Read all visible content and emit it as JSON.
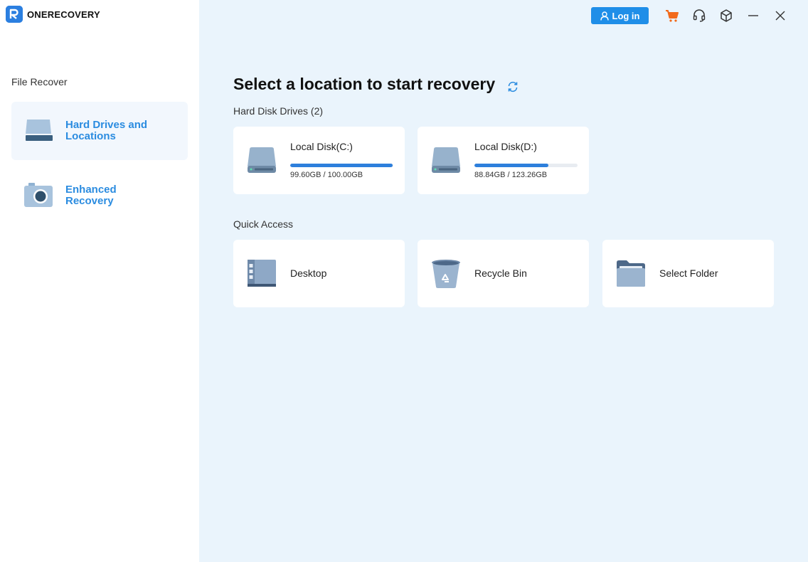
{
  "app": {
    "brand_name": "ONERECOVERY",
    "accent_color": "#2b8ce0",
    "login_label": "Log in"
  },
  "topbar": {
    "icons": [
      "user-icon",
      "cart-icon",
      "headset-icon",
      "cube-icon",
      "minimize-icon",
      "close-icon"
    ]
  },
  "sidebar": {
    "section_label": "File Recover",
    "items": [
      {
        "label": "Hard Drives and Locations",
        "icon": "hard-drive-icon",
        "active": true
      },
      {
        "label": "Enhanced Recovery",
        "icon": "camera-icon",
        "active": false
      }
    ]
  },
  "main": {
    "title": "Select a location to start recovery",
    "hdd_group_label": "Hard Disk Drives (2)",
    "disks": [
      {
        "name": "Local Disk(C:)",
        "size_text": "99.60GB / 100.00GB",
        "used_fraction": 0.996
      },
      {
        "name": "Local Disk(D:)",
        "size_text": "88.84GB / 123.26GB",
        "used_fraction": 0.72
      }
    ],
    "quick_access_label": "Quick Access",
    "quick_access": [
      {
        "label": "Desktop",
        "icon": "desktop-icon"
      },
      {
        "label": "Recycle Bin",
        "icon": "recycle-bin-icon"
      },
      {
        "label": "Select Folder",
        "icon": "folder-icon"
      }
    ]
  }
}
